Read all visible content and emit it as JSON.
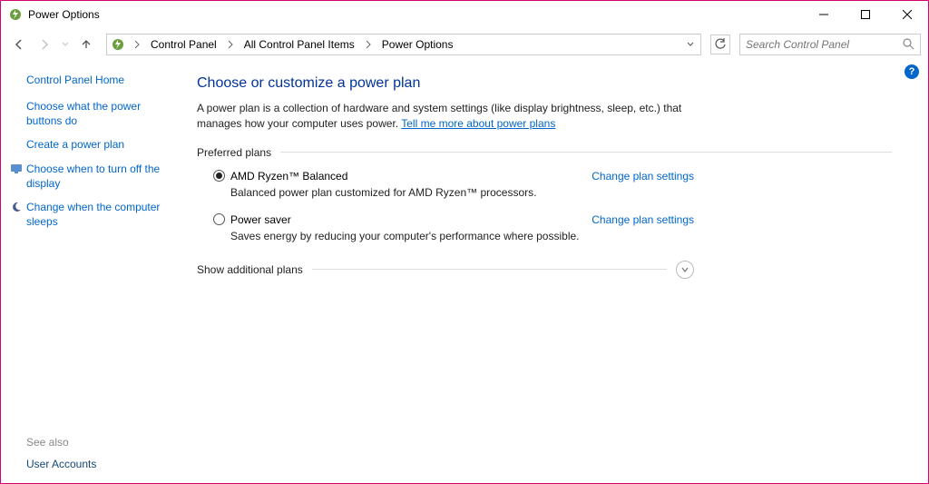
{
  "window": {
    "title": "Power Options"
  },
  "breadcrumb": {
    "items": [
      "Control Panel",
      "All Control Panel Items",
      "Power Options"
    ]
  },
  "search": {
    "placeholder": "Search Control Panel"
  },
  "sidebar": {
    "home": "Control Panel Home",
    "links": [
      {
        "label": "Choose what the power buttons do"
      },
      {
        "label": "Create a power plan"
      },
      {
        "label": "Choose when to turn off the display"
      },
      {
        "label": "Change when the computer sleeps"
      }
    ],
    "see_also_heading": "See also",
    "see_also": [
      "User Accounts"
    ]
  },
  "main": {
    "heading": "Choose or customize a power plan",
    "description_prefix": "A power plan is a collection of hardware and system settings (like display brightness, sleep, etc.) that manages how your computer uses power. ",
    "description_link": "Tell me more about power plans",
    "preferred_label": "Preferred plans",
    "plans": [
      {
        "name": "AMD Ryzen™ Balanced",
        "selected": true,
        "desc": "Balanced power plan customized for AMD Ryzen™ processors.",
        "change": "Change plan settings"
      },
      {
        "name": "Power saver",
        "selected": false,
        "desc": "Saves energy by reducing your computer's performance where possible.",
        "change": "Change plan settings"
      }
    ],
    "show_additional": "Show additional plans"
  }
}
